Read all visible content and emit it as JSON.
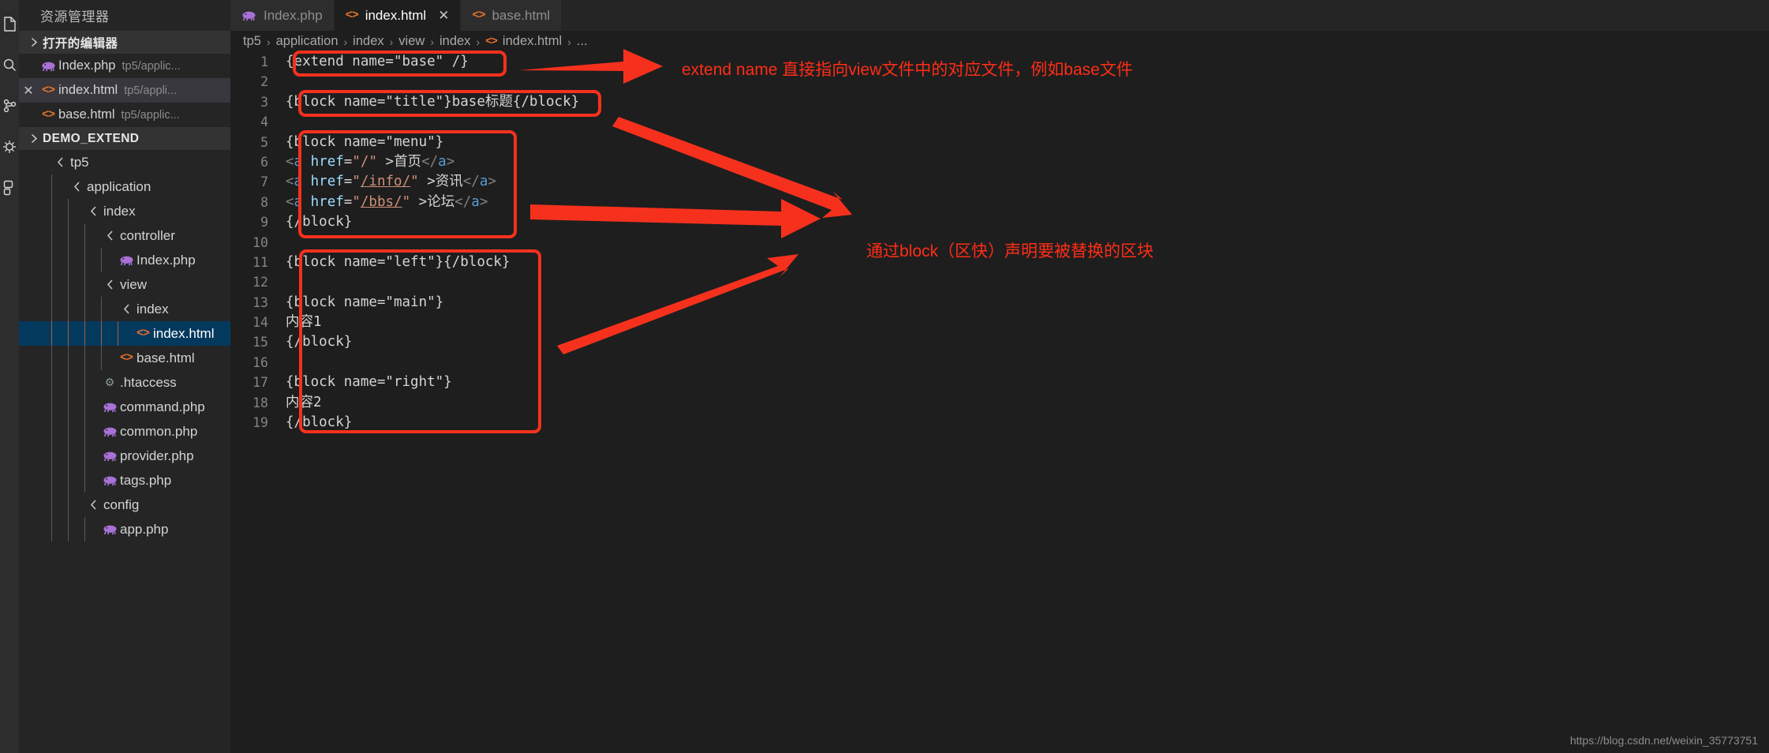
{
  "activitybar": {
    "icons": [
      "files-icon",
      "search-icon",
      "source-control-icon",
      "debug-icon",
      "extensions-icon"
    ]
  },
  "sidebar": {
    "title": "资源管理器",
    "open_editors": {
      "label": "打开的编辑器",
      "chevron": "chevron-right-icon",
      "items": [
        {
          "name": "Index.php",
          "path": "tp5/applic...",
          "icon": "php-icon",
          "closable": false,
          "active": false
        },
        {
          "name": "index.html",
          "path": "tp5/appli...",
          "icon": "html-icon",
          "closable": true,
          "active": true
        },
        {
          "name": "base.html",
          "path": "tp5/applic...",
          "icon": "html-icon",
          "closable": false,
          "active": false
        }
      ]
    },
    "project": {
      "label": "DEMO_EXTEND",
      "chevron": "chevron-right-icon",
      "tree": [
        {
          "label": "tp5",
          "depth": 1,
          "type": "folder",
          "icon": "chevron-left-icon"
        },
        {
          "label": "application",
          "depth": 2,
          "type": "folder",
          "icon": "chevron-left-icon"
        },
        {
          "label": "index",
          "depth": 3,
          "type": "folder",
          "icon": "chevron-left-icon"
        },
        {
          "label": "controller",
          "depth": 4,
          "type": "folder",
          "icon": "chevron-left-icon"
        },
        {
          "label": "Index.php",
          "depth": 5,
          "type": "file",
          "icon": "php-icon"
        },
        {
          "label": "view",
          "depth": 4,
          "type": "folder",
          "icon": "chevron-left-icon"
        },
        {
          "label": "index",
          "depth": 5,
          "type": "folder",
          "icon": "chevron-left-icon"
        },
        {
          "label": "index.html",
          "depth": 6,
          "type": "file",
          "icon": "html-icon",
          "selected": true
        },
        {
          "label": "base.html",
          "depth": 5,
          "type": "file",
          "icon": "html-icon"
        },
        {
          "label": ".htaccess",
          "depth": 4,
          "type": "file",
          "icon": "gear-icon"
        },
        {
          "label": "command.php",
          "depth": 4,
          "type": "file",
          "icon": "php-icon"
        },
        {
          "label": "common.php",
          "depth": 4,
          "type": "file",
          "icon": "php-icon"
        },
        {
          "label": "provider.php",
          "depth": 4,
          "type": "file",
          "icon": "php-icon"
        },
        {
          "label": "tags.php",
          "depth": 4,
          "type": "file",
          "icon": "php-icon"
        },
        {
          "label": "config",
          "depth": 3,
          "type": "folder",
          "icon": "chevron-left-icon"
        },
        {
          "label": "app.php",
          "depth": 4,
          "type": "file",
          "icon": "php-icon"
        }
      ]
    }
  },
  "tabs": [
    {
      "label": "Index.php",
      "icon": "php-icon",
      "active": false,
      "closable": false
    },
    {
      "label": "index.html",
      "icon": "html-icon",
      "active": true,
      "closable": true
    },
    {
      "label": "base.html",
      "icon": "html-icon",
      "active": false,
      "closable": false
    }
  ],
  "breadcrumb": {
    "items": [
      "tp5",
      "application",
      "index",
      "view",
      "index",
      "index.html",
      "..."
    ],
    "file_icon": "html-icon",
    "separator": "›"
  },
  "code": {
    "language": "html",
    "lines": [
      {
        "n": 1,
        "text": "{extend name=\"base\" /}"
      },
      {
        "n": 2,
        "text": ""
      },
      {
        "n": 3,
        "text": "{block name=\"title\"}base标题{/block}"
      },
      {
        "n": 4,
        "text": ""
      },
      {
        "n": 5,
        "text": "{block name=\"menu\"}"
      },
      {
        "n": 6,
        "text": "<a href=\"/\" >首页</a>"
      },
      {
        "n": 7,
        "text": "<a href=\"/info/\" >资讯</a>"
      },
      {
        "n": 8,
        "text": "<a href=\"/bbs/\" >论坛</a>"
      },
      {
        "n": 9,
        "text": "{/block}"
      },
      {
        "n": 10,
        "text": ""
      },
      {
        "n": 11,
        "text": "{block name=\"left\"}{/block}"
      },
      {
        "n": 12,
        "text": ""
      },
      {
        "n": 13,
        "text": "{block name=\"main\"}"
      },
      {
        "n": 14,
        "text": "内容1"
      },
      {
        "n": 15,
        "text": "{/block}"
      },
      {
        "n": 16,
        "text": ""
      },
      {
        "n": 17,
        "text": "{block name=\"right\"}"
      },
      {
        "n": 18,
        "text": "内容2"
      },
      {
        "n": 19,
        "text": "{/block}"
      }
    ]
  },
  "annotations": {
    "color": "#ff2d16",
    "notes": [
      {
        "id": "note-extend",
        "text": "extend name 直接指向view文件中的对应文件，例如base文件"
      },
      {
        "id": "note-block",
        "text": "通过block（区快）声明要被替换的区块"
      }
    ],
    "boxes": [
      {
        "id": "box-extend",
        "lines": "1"
      },
      {
        "id": "box-title",
        "lines": "3"
      },
      {
        "id": "box-menu",
        "lines": "5-9"
      },
      {
        "id": "box-blocks",
        "lines": "11-19"
      }
    ]
  },
  "watermark": "https://blog.csdn.net/weixin_35773751"
}
